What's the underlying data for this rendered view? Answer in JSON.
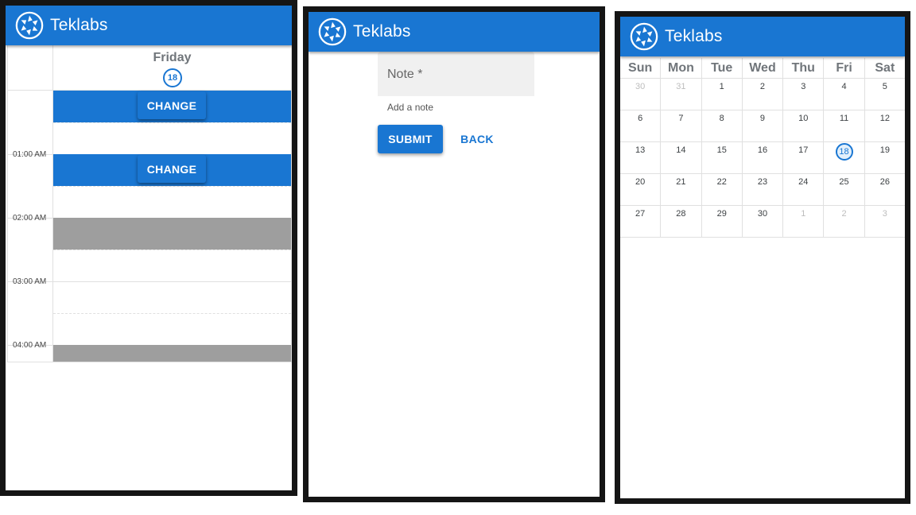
{
  "app": {
    "title": "Teklabs",
    "brand_color": "#1976d2",
    "logo_icon": "aperture-logo-icon"
  },
  "day_view": {
    "day_name": "Friday",
    "day_number": "18",
    "time_labels": [
      "01:00 AM",
      "02:00 AM",
      "03:00 AM",
      "04:00 AM"
    ],
    "events": [
      {
        "color": "#1976d2",
        "button_label": "CHANGE"
      },
      {
        "color": "#1976d2",
        "button_label": "CHANGE"
      },
      {
        "color": "#9e9e9e"
      },
      {
        "color": "#9e9e9e"
      }
    ]
  },
  "note_form": {
    "field_label": "Note *",
    "helper_text": "Add a note",
    "submit_label": "SUBMIT",
    "back_label": "BACK"
  },
  "month_view": {
    "weekdays": [
      "Sun",
      "Mon",
      "Tue",
      "Wed",
      "Thu",
      "Fri",
      "Sat"
    ],
    "today": "18",
    "weeks": [
      [
        {
          "d": "30",
          "other": true
        },
        {
          "d": "31",
          "other": true
        },
        {
          "d": "1"
        },
        {
          "d": "2"
        },
        {
          "d": "3"
        },
        {
          "d": "4"
        },
        {
          "d": "5"
        }
      ],
      [
        {
          "d": "6"
        },
        {
          "d": "7"
        },
        {
          "d": "8"
        },
        {
          "d": "9"
        },
        {
          "d": "10"
        },
        {
          "d": "11"
        },
        {
          "d": "12"
        }
      ],
      [
        {
          "d": "13"
        },
        {
          "d": "14"
        },
        {
          "d": "15"
        },
        {
          "d": "16"
        },
        {
          "d": "17"
        },
        {
          "d": "18",
          "today": true
        },
        {
          "d": "19"
        }
      ],
      [
        {
          "d": "20"
        },
        {
          "d": "21"
        },
        {
          "d": "22"
        },
        {
          "d": "23"
        },
        {
          "d": "24"
        },
        {
          "d": "25"
        },
        {
          "d": "26"
        }
      ],
      [
        {
          "d": "27"
        },
        {
          "d": "28"
        },
        {
          "d": "29"
        },
        {
          "d": "30"
        },
        {
          "d": "1",
          "other": true
        },
        {
          "d": "2",
          "other": true
        },
        {
          "d": "3",
          "other": true
        }
      ]
    ]
  }
}
